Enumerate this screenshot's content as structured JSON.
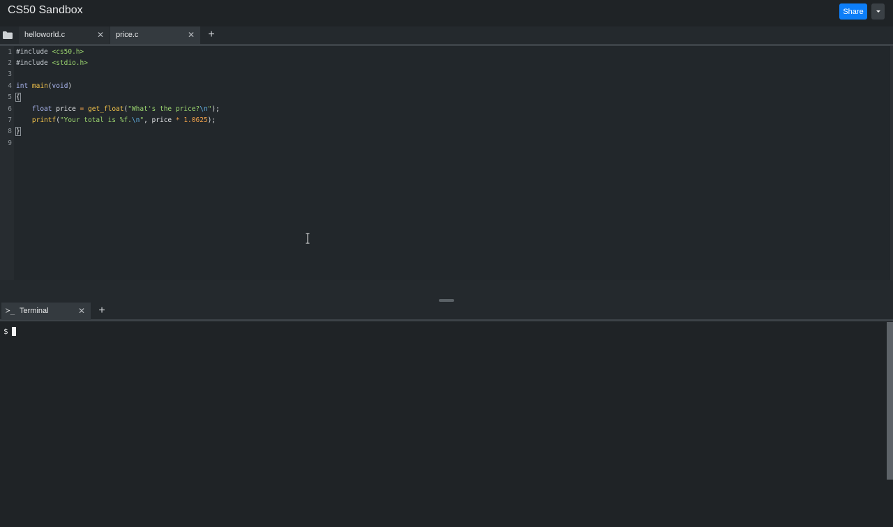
{
  "app": {
    "title": "CS50 Sandbox",
    "share_label": "Share"
  },
  "editor": {
    "tabs": [
      {
        "label": "helloworld.c",
        "close": "✕",
        "active": false
      },
      {
        "label": "price.c",
        "close": "✕",
        "active": true
      }
    ],
    "add_tab": "+",
    "line_numbers": [
      "1",
      "2",
      "3",
      "4",
      "5",
      "6",
      "7",
      "8",
      "9"
    ],
    "code": {
      "l1_directive": "#include",
      "l1_header": " <cs50.h>",
      "l2_directive": "#include",
      "l2_header": " <stdio.h>",
      "l4_type": "int",
      "l4_space": " ",
      "l4_fn": "main",
      "l4_paren_open": "(",
      "l4_void": "void",
      "l4_paren_close": ")",
      "l5_brace": "{",
      "l6_indent": "    ",
      "l6_type": "float",
      "l6_var": " price ",
      "l6_eq": "=",
      "l6_sp": " ",
      "l6_fn": "get_float",
      "l6_open": "(",
      "l6_str": "\"What's the price?",
      "l6_esc": "\\n",
      "l6_str_end": "\"",
      "l6_close": ");",
      "l7_indent": "    ",
      "l7_fn": "printf",
      "l7_open": "(",
      "l7_str": "\"Your total is %f.",
      "l7_esc": "\\n",
      "l7_str_end": "\"",
      "l7_args": ", price ",
      "l7_op": "*",
      "l7_sp": " ",
      "l7_num": "1.0625",
      "l7_close": ");",
      "l8_brace": "}"
    }
  },
  "terminal": {
    "tab_icon": "≻_",
    "tab_label": "Terminal",
    "tab_close": "✕",
    "add_tab": "+",
    "prompt": "$"
  },
  "icons": {
    "folder": "folder-icon",
    "caret": "caret-down-icon",
    "terminal": "terminal-icon",
    "ibeam": "text-cursor-icon"
  },
  "colors": {
    "accent": "#0d7ef8",
    "background": "#1f2326",
    "editor_background": "#22272b"
  }
}
